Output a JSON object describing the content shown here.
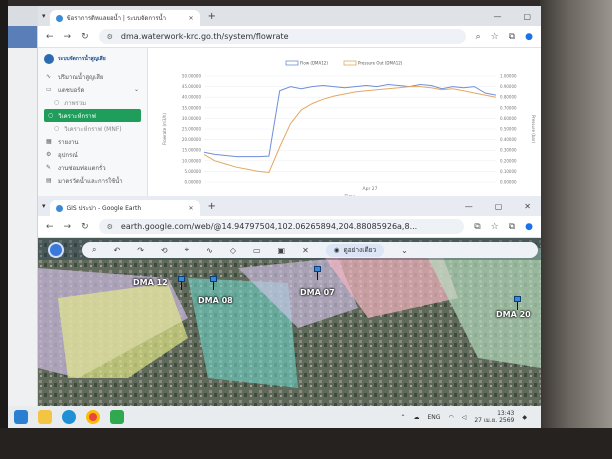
{
  "browser_top": {
    "tab_title": "ข้อราการดิหแลยอนํ้า | ระบบจัดการน้ำ",
    "url": "dma.waterwork-krc.go.th/system/flowrate"
  },
  "sidebar": {
    "brand": "ระบบจัดการน้ำสูญเสีย",
    "items": [
      {
        "label": "ปริมาณน้ำสูญเสีย",
        "icon": "chart-icon"
      },
      {
        "label": "แดชบอร์ด",
        "icon": "dashboard-icon"
      },
      {
        "label": "ภาพรวม",
        "icon": "dot-icon"
      },
      {
        "label": "วิเคราะห์กราฟ",
        "icon": "dot-icon"
      },
      {
        "label": "วิเคราะห์กราฟ (MNF)",
        "icon": "dot-icon"
      },
      {
        "label": "รายงาน",
        "icon": "table-icon"
      },
      {
        "label": "อุปกรณ์",
        "icon": "gear-icon"
      },
      {
        "label": "งานซ่อมท่อแตกรั่ว",
        "icon": "wrench-icon"
      },
      {
        "label": "มาตรวัดน้ำและการใช้น้ำ",
        "icon": "meter-icon"
      }
    ]
  },
  "chart_data": {
    "type": "line",
    "legend": [
      "Flow (DMA12)",
      "Pressure Out (DMA12)"
    ],
    "xlabel": "Time",
    "x_tick": "Apr 27",
    "ylabel_left": "Flowrate (m3/h)",
    "ylabel_right": "Pressure (bar)",
    "y_left_ticks": [
      "0.00000",
      "5.00000",
      "10.00000",
      "15.00000",
      "20.00000",
      "25.00000",
      "30.00000",
      "35.00000",
      "40.00000",
      "45.00000",
      "50.00000"
    ],
    "y_right_ticks": [
      "0.00000",
      "0.10000",
      "0.20000",
      "0.30000",
      "0.40000",
      "0.50000",
      "0.60000",
      "0.70000",
      "0.80000",
      "0.90000",
      "1.00000"
    ],
    "ylim_left": [
      0,
      50
    ],
    "ylim_right": [
      0,
      1
    ],
    "series": [
      {
        "name": "Flow (DMA12)",
        "color": "#6f8fd8",
        "values": [
          14,
          13,
          12.5,
          12,
          12,
          12,
          12.2,
          43,
          45,
          44,
          45,
          45.5,
          45,
          44.5,
          45,
          45.5,
          45,
          46,
          45.5,
          45,
          46,
          45.5,
          44,
          45,
          44.5,
          45,
          42,
          41
        ]
      },
      {
        "name": "Pressure Out (DMA12)",
        "color": "#e3a864",
        "values": [
          0.26,
          0.2,
          0.17,
          0.14,
          0.12,
          0.1,
          0.09,
          0.33,
          0.55,
          0.68,
          0.74,
          0.78,
          0.81,
          0.83,
          0.85,
          0.86,
          0.87,
          0.88,
          0.89,
          0.9,
          0.9,
          0.89,
          0.87,
          0.88,
          0.86,
          0.84,
          0.82,
          0.8
        ]
      }
    ]
  },
  "browser_bottom": {
    "tab_title": "GIS ประปา - Google Earth",
    "url": "earth.google.com/web/@14.94797504,102.06265894,204.88085926a,8..."
  },
  "map": {
    "view_button": "ดูอย่างเดียว",
    "labels": [
      "DMA 12",
      "DMA 08",
      "DMA 07",
      "DMA 20"
    ]
  },
  "taskbar": {
    "lang": "ENG",
    "time": "13:43",
    "date": "27 เม.ย. 2569"
  }
}
